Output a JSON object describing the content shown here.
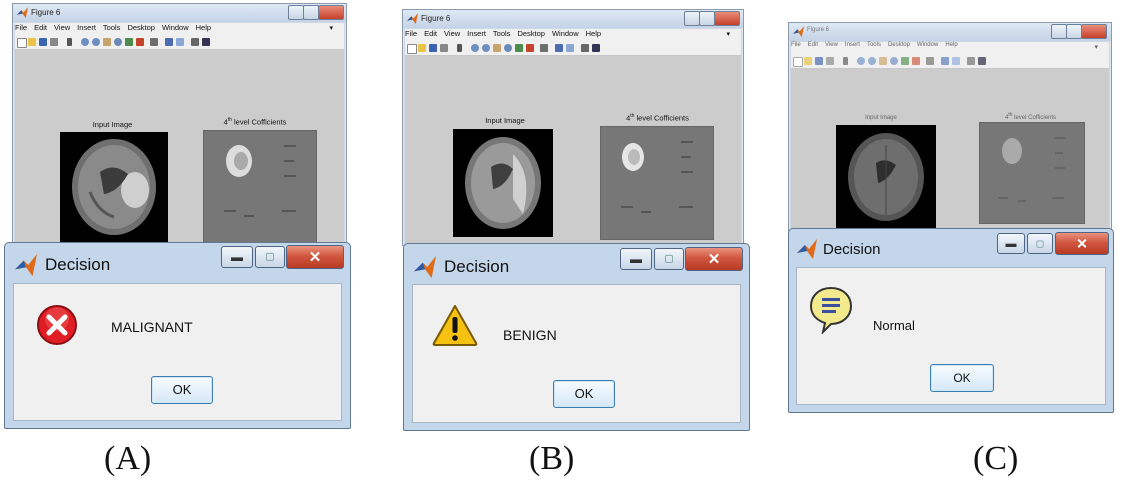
{
  "figure": {
    "title": "Figure 6",
    "menu": [
      "File",
      "Edit",
      "View",
      "Insert",
      "Tools",
      "Desktop",
      "Window",
      "Help"
    ],
    "input_caption": "Input Image",
    "coef_caption_num": "4",
    "coef_caption_sup": "th",
    "coef_caption_rest": " level Cofficients"
  },
  "dialog": {
    "title": "Decision",
    "ok_label": "OK"
  },
  "panels": [
    {
      "label": "(A)",
      "message": "MALIGNANT",
      "icon": "error-icon",
      "icon_color": "#e01d24"
    },
    {
      "label": "(B)",
      "message": "BENIGN",
      "icon": "warning-icon",
      "icon_color": "#f5c211"
    },
    {
      "label": "(C)",
      "message": "Normal",
      "icon": "help-balloon-icon",
      "icon_color": "#f3ea8d"
    }
  ],
  "colors": {
    "titlebar": "#c3d6ea",
    "close_button": "#c4412b",
    "dialog_body": "#f0f0f0",
    "figure_canvas": "#cccccc"
  }
}
